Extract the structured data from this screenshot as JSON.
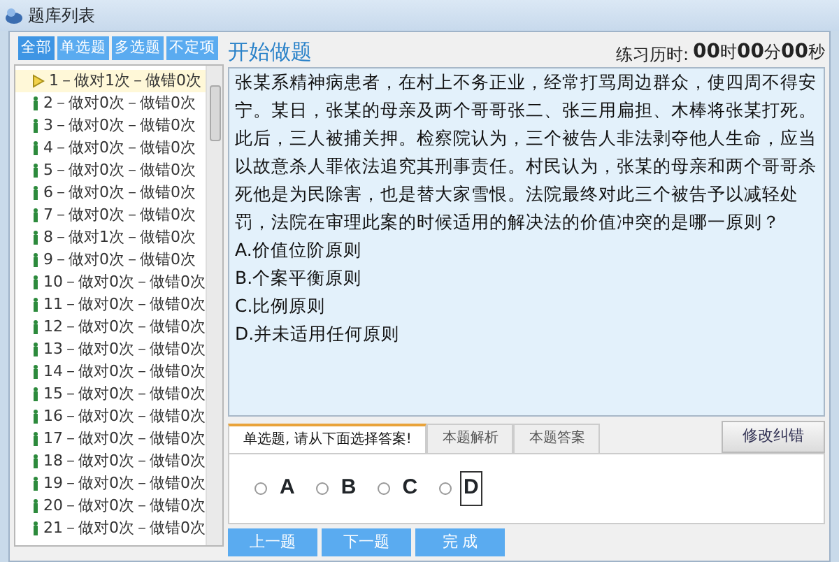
{
  "window": {
    "title": "题库列表"
  },
  "filters": [
    {
      "label": "全部",
      "selected": true
    },
    {
      "label": "单选题",
      "selected": false
    },
    {
      "label": "多选题",
      "selected": false
    },
    {
      "label": "不定项",
      "selected": false
    }
  ],
  "questions": [
    {
      "label": "1－做对1次－做错0次",
      "selected": true
    },
    {
      "label": "2－做对0次－做错0次",
      "selected": false
    },
    {
      "label": "3－做对0次－做错0次",
      "selected": false
    },
    {
      "label": "4－做对0次－做错0次",
      "selected": false
    },
    {
      "label": "5－做对0次－做错0次",
      "selected": false
    },
    {
      "label": "6－做对0次－做错0次",
      "selected": false
    },
    {
      "label": "7－做对0次－做错0次",
      "selected": false
    },
    {
      "label": "8－做对1次－做错0次",
      "selected": false
    },
    {
      "label": "9－做对0次－做错0次",
      "selected": false
    },
    {
      "label": "10－做对0次－做错0次",
      "selected": false
    },
    {
      "label": "11－做对0次－做错0次",
      "selected": false
    },
    {
      "label": "12－做对0次－做错0次",
      "selected": false
    },
    {
      "label": "13－做对0次－做错0次",
      "selected": false
    },
    {
      "label": "14－做对0次－做错0次",
      "selected": false
    },
    {
      "label": "15－做对0次－做错0次",
      "selected": false
    },
    {
      "label": "16－做对0次－做错0次",
      "selected": false
    },
    {
      "label": "17－做对0次－做错0次",
      "selected": false
    },
    {
      "label": "18－做对0次－做错0次",
      "selected": false
    },
    {
      "label": "19－做对0次－做错0次",
      "selected": false
    },
    {
      "label": "20－做对0次－做错0次",
      "selected": false
    },
    {
      "label": "21－做对0次－做错0次",
      "selected": false
    }
  ],
  "header": {
    "title": "开始做题",
    "timer_label": "练习历时:",
    "timer": "**00**时**00**分**00**秒"
  },
  "question": {
    "text": "张某系精神病患者，在村上不务正业，经常打骂周边群众，使四周不得安宁。某日，张某的母亲及两个哥哥张二、张三用扁担、木棒将张某打死。此后，三人被捕关押。检察院认为，三个被告人非法剥夺他人生命，应当以故意杀人罪依法追究其刑事责任。村民认为，张某的母亲和两个哥哥杀死他是为民除害，也是替大家雪恨。法院最终对此三个被告予以减轻处罚，法院在审理此案的时候适用的解决法的价值冲突的是哪一原则？",
    "options": [
      "A.价值位阶原则",
      "B.个案平衡原则",
      "C.比例原则",
      "D.并未适用任何原则"
    ]
  },
  "tabs": [
    {
      "label": "单选题, 请从下面选择答案!",
      "selected": true
    },
    {
      "label": "本题解析",
      "selected": false
    },
    {
      "label": "本题答案",
      "selected": false
    }
  ],
  "correct_button": "修改纠错",
  "answers": [
    {
      "label": "A",
      "selected": false,
      "focused": false
    },
    {
      "label": "B",
      "selected": false,
      "focused": false
    },
    {
      "label": "C",
      "selected": false,
      "focused": false
    },
    {
      "label": "D",
      "selected": false,
      "focused": true
    }
  ],
  "buttons": [
    "上一题",
    "下一题",
    "完 成"
  ]
}
